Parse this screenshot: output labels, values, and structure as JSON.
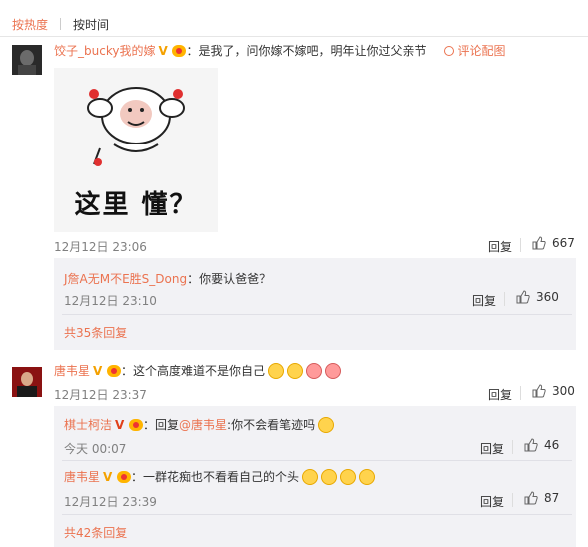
{
  "tabs": [
    {
      "label": "按热度"
    },
    {
      "label": "按时间"
    }
  ],
  "comments": [
    {
      "user": "饺子_bucky我的嫁",
      "text": "：是我了，问你嫁不嫁吧，明年让你过父亲节",
      "pic_link": "评论配图",
      "meme_text": "这里 懂？",
      "time": "12月12日 23:06",
      "reply": "回复",
      "likes": "667",
      "replies": [
        {
          "user": "J詹A无M不E胜S_Dong",
          "text": "：你要认爸爸？",
          "time": "12月12日 23:10",
          "reply": "回复",
          "likes": "360"
        }
      ],
      "more": "共35条回复"
    },
    {
      "user": "唐韦星",
      "text": "：这个高度难道不是你自己",
      "time": "12月12日 23:37",
      "reply": "回复",
      "likes": "300",
      "replies": [
        {
          "user": "棋士柯洁",
          "text_pre": "：回复",
          "mention": "@唐韦星",
          "text": ":你不会看笔迹吗",
          "time": "今天 00:07",
          "reply": "回复",
          "likes": "46"
        },
        {
          "user": "唐韦星",
          "text": "：一群花痴也不看看自己的个头",
          "time": "12月12日 23:39",
          "reply": "回复",
          "likes": "87"
        }
      ],
      "more": "共42条回复"
    }
  ],
  "icons": {
    "verified": "verified-v-icon",
    "vip": "vip-crown-icon",
    "like": "thumbs-up-icon",
    "picture": "picture-icon"
  },
  "colors": {
    "accent": "#eb7350",
    "muted": "#808080",
    "sub_bg": "#f2f2f5"
  }
}
